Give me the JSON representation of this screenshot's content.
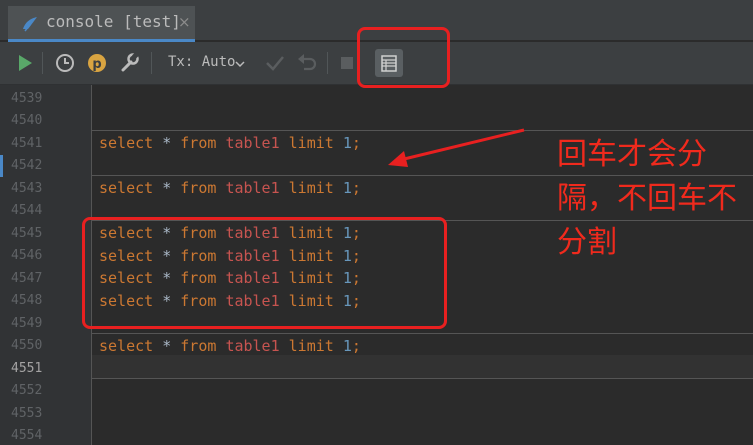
{
  "tab": {
    "title": "console [test]",
    "close_glyph": "×",
    "icon": "database-console-icon"
  },
  "toolbar": {
    "tx_label": "Tx: Auto",
    "icons": [
      "run-icon",
      "history-icon",
      "p-badge-icon",
      "settings-wrench-icon",
      "commit-check-icon",
      "rollback-icon",
      "stop-icon",
      "output-format-icon"
    ]
  },
  "editor": {
    "line_numbers": [
      "4539",
      "4540",
      "4541",
      "4542",
      "4543",
      "4544",
      "4545",
      "4546",
      "4547",
      "4548",
      "4549",
      "4550",
      "4551",
      "4552",
      "4553",
      "4554"
    ],
    "active_line": "4551",
    "lines": [
      {
        "ln": "4541",
        "kw1": "select",
        "star": "*",
        "kw2": "from",
        "table": "table1",
        "kw3": "limit",
        "num": "1",
        "end": ";"
      },
      {
        "ln": "4543",
        "kw1": "select",
        "star": "*",
        "kw2": "from",
        "table": "table1",
        "kw3": "limit",
        "num": "1",
        "end": ";"
      },
      {
        "ln": "4545",
        "kw1": "select",
        "star": "*",
        "kw2": "from",
        "table": "table1",
        "kw3": "limit",
        "num": "1",
        "end": ";"
      },
      {
        "ln": "4546",
        "kw1": "select",
        "star": "*",
        "kw2": "from",
        "table": "table1",
        "kw3": "limit",
        "num": "1",
        "end": ";"
      },
      {
        "ln": "4547",
        "kw1": "select",
        "star": "*",
        "kw2": "from",
        "table": "table1",
        "kw3": "limit",
        "num": "1",
        "end": ";"
      },
      {
        "ln": "4548",
        "kw1": "select",
        "star": "*",
        "kw2": "from",
        "table": "table1",
        "kw3": "limit",
        "num": "1",
        "end": ";"
      },
      {
        "ln": "4550",
        "kw1": "select",
        "star": "*",
        "kw2": "from",
        "table": "table1",
        "kw3": "limit",
        "num": "1",
        "end": ";"
      }
    ]
  },
  "annotation": {
    "text": "回车才会分隔，不回车不分割",
    "color": "#f02a1d"
  },
  "colors": {
    "background": "#2b2b2b",
    "keyword": "#cc7832",
    "table": "#c75450",
    "number": "#6897bb",
    "annotation": "#e82020"
  }
}
